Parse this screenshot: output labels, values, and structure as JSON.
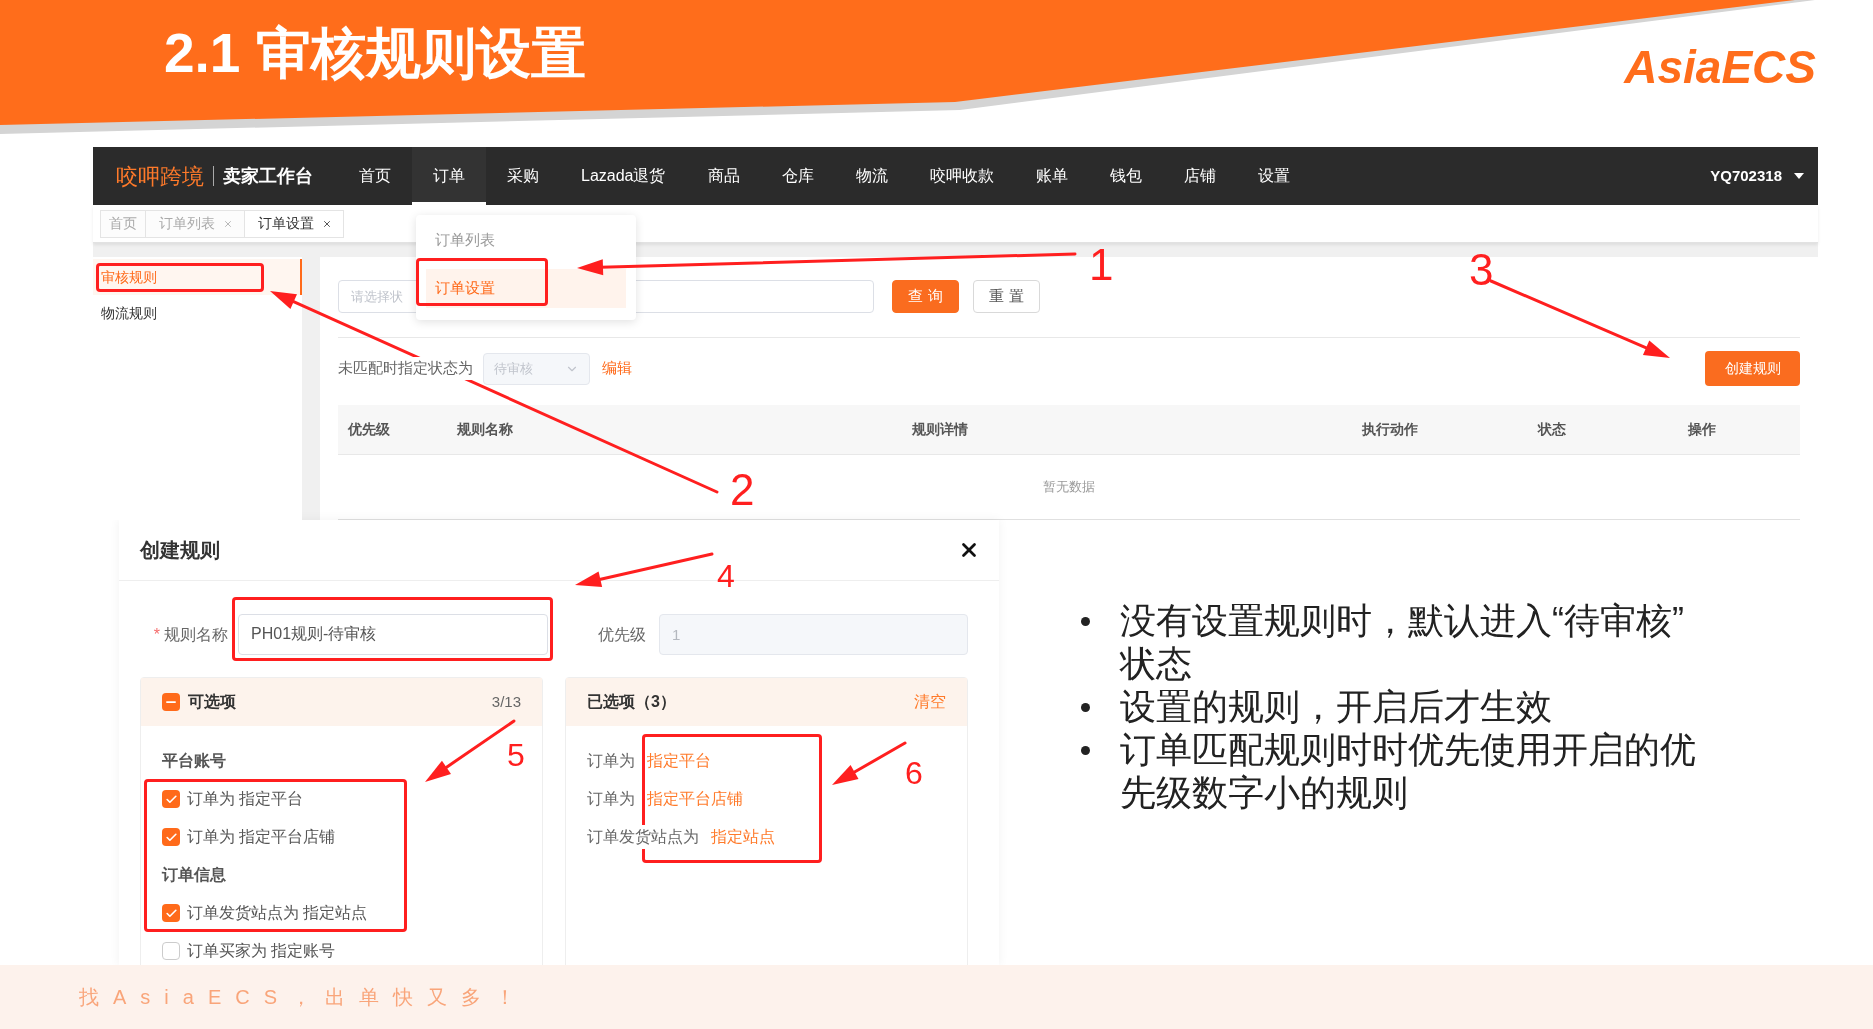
{
  "slide": {
    "title": "2.1 审核规则设置",
    "logo": "AsiaECS",
    "footer": "找AsiaECS，出单快又多！"
  },
  "app": {
    "brand": "咬呷跨境",
    "workspace": "卖家工作台",
    "nav": [
      {
        "label": "首页",
        "selected": false
      },
      {
        "label": "订单",
        "selected": true
      },
      {
        "label": "采购",
        "selected": false
      },
      {
        "label": "Lazada退货",
        "selected": false
      },
      {
        "label": "商品",
        "selected": false
      },
      {
        "label": "仓库",
        "selected": false
      },
      {
        "label": "物流",
        "selected": false
      },
      {
        "label": "咬呷收款",
        "selected": false
      },
      {
        "label": "账单",
        "selected": false
      },
      {
        "label": "钱包",
        "selected": false
      },
      {
        "label": "店铺",
        "selected": false
      },
      {
        "label": "设置",
        "selected": false
      }
    ],
    "account": "YQ702318",
    "nav_menu": [
      {
        "label": "订单列表",
        "selected": false
      },
      {
        "label": "订单设置",
        "selected": true
      }
    ],
    "tabs": [
      {
        "label": "首页",
        "closable": false,
        "selected": false
      },
      {
        "label": "订单列表",
        "closable": true,
        "selected": false
      },
      {
        "label": "订单设置",
        "closable": true,
        "selected": true
      }
    ],
    "sidebar": [
      {
        "label": "审核规则",
        "selected": true
      },
      {
        "label": "物流规则",
        "selected": false
      }
    ],
    "filter": {
      "placeholder": "请选择状",
      "buttons": [
        {
          "label": "查 询",
          "kind": "primary"
        },
        {
          "label": "重 置",
          "kind": "default"
        }
      ]
    },
    "default_status": {
      "label": "未匹配时指定状态为",
      "value": "待审核",
      "disabled": true,
      "action": "编辑"
    },
    "create_button": "创建规则",
    "table": {
      "columns": [
        "优先级",
        "规则名称",
        "规则详情",
        "执行动作",
        "状态",
        "操作"
      ],
      "empty_text": "暂无数据"
    }
  },
  "dialog": {
    "title": "创建规则",
    "name_field": {
      "required_mark": "*",
      "label": "规则名称",
      "value": "PH01规则-待审核"
    },
    "priority_field": {
      "label": "优先级",
      "value": "1",
      "disabled": true
    },
    "available": {
      "title": "可选项",
      "count": "3/13",
      "indeterminate": true,
      "groups": [
        {
          "title": "平台账号",
          "items": [
            {
              "label": "订单为 指定平台",
              "checked": true
            },
            {
              "label": "订单为 指定平台店铺",
              "checked": true
            }
          ]
        },
        {
          "title": "订单信息",
          "items": [
            {
              "label": "订单发货站点为 指定站点",
              "checked": true
            },
            {
              "label": "订单买家为 指定账号",
              "checked": false
            }
          ]
        }
      ]
    },
    "chosen": {
      "title": "已选项（3）",
      "clear": "清空",
      "items": [
        {
          "prefix": "订单为",
          "value": "指定平台"
        },
        {
          "prefix": "订单为",
          "value": "指定平台店铺"
        },
        {
          "prefix": "订单发货站点为",
          "value": "指定站点"
        }
      ]
    }
  },
  "notes": [
    "没有设置规则时，默认进入“待审核”状态",
    "设置的规则，开启后才生效",
    "订单匹配规则时时优先使用开启的优先级数字小的规则"
  ],
  "annotations": [
    {
      "label": "1"
    },
    {
      "label": "2"
    },
    {
      "label": "3"
    },
    {
      "label": "4"
    },
    {
      "label": "5"
    },
    {
      "label": "6"
    }
  ]
}
